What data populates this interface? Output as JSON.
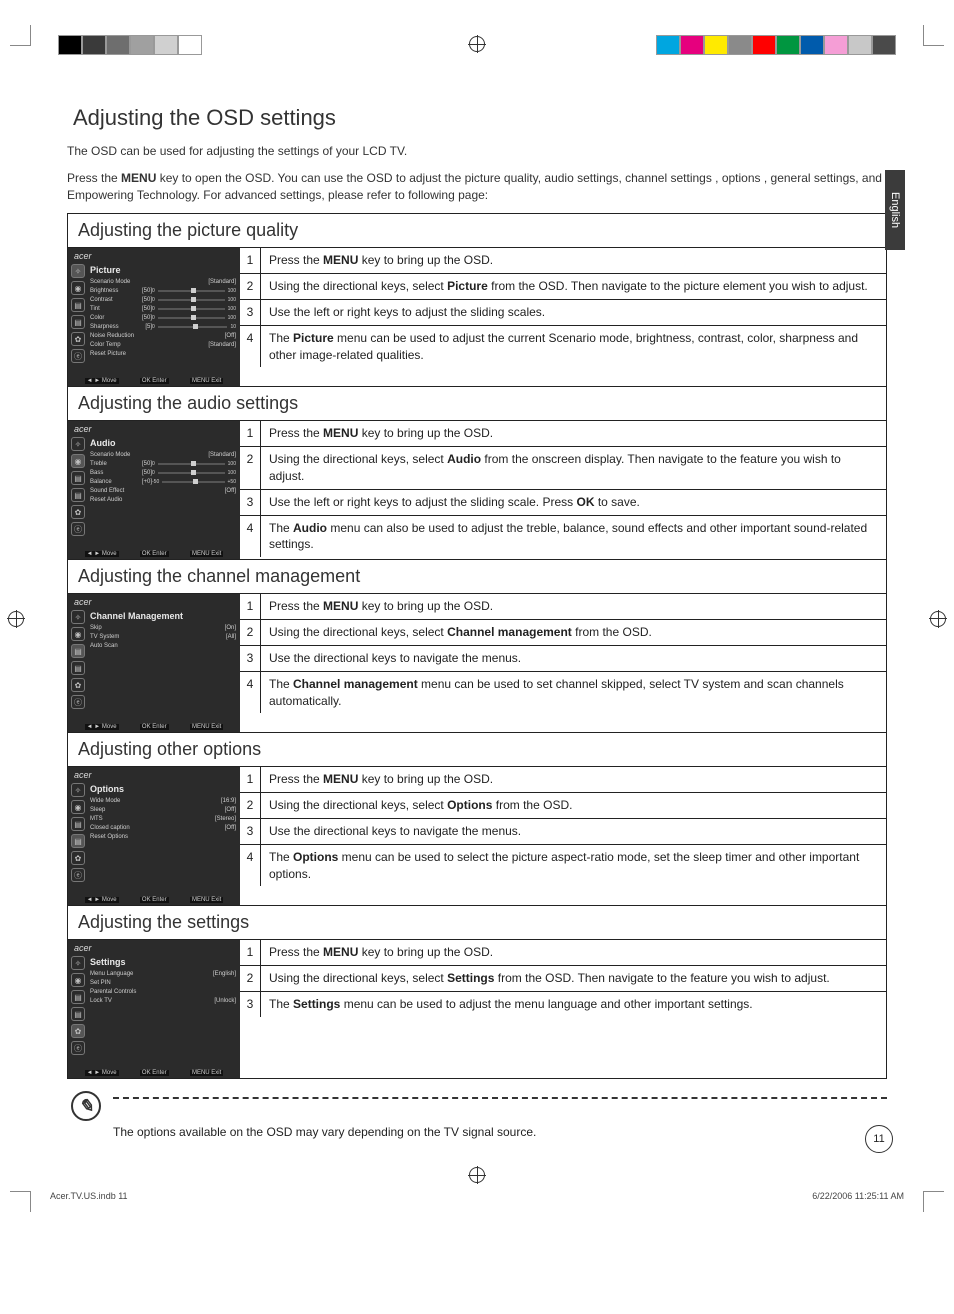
{
  "lang_tab": "English",
  "page_number": "11",
  "title": "Adjusting the OSD settings",
  "intro_plain": "The OSD can be used for adjusting the settings of your LCD TV.",
  "intro2_pre": "Press the ",
  "intro2_b": "MENU",
  "intro2_post": " key to open the OSD. You can use the OSD to adjust the picture quality, audio settings, channel settings , options , general settings, and Empowering Technology. For advanced settings, please refer to following page:",
  "sections": [
    {
      "title": "Adjusting the picture quality",
      "osd": {
        "brand": "acer",
        "menu": "Picture",
        "rows": [
          {
            "label": "Scenario Mode",
            "right": "[Standard]"
          },
          {
            "label": "Brightness",
            "val": "[50]",
            "slider": true,
            "min": "0",
            "max": "100"
          },
          {
            "label": "Contrast",
            "val": "[50]",
            "slider": true,
            "min": "0",
            "max": "100"
          },
          {
            "label": "Tint",
            "val": "[50]",
            "slider": true,
            "min": "0",
            "max": "100"
          },
          {
            "label": "Color",
            "val": "[50]",
            "slider": true,
            "min": "0",
            "max": "100"
          },
          {
            "label": "Sharpness",
            "val": "[5]",
            "slider": true,
            "min": "0",
            "max": "10"
          },
          {
            "label": "Noise Reduction",
            "right": "[Off]"
          },
          {
            "label": "Color Temp",
            "right": "[Standard]"
          },
          {
            "label": "Reset Picture"
          }
        ],
        "footer": [
          "◄ ► Move",
          "OK  Enter",
          "MENU  Exit"
        ]
      },
      "steps": [
        {
          "n": "1",
          "pre": "Press the ",
          "b": "MENU",
          "post": " key to bring up the OSD."
        },
        {
          "n": "2",
          "pre": "Using the directional keys, select ",
          "b": "Picture",
          "post": " from the OSD. Then navigate to the picture element you wish to adjust."
        },
        {
          "n": "3",
          "pre": "Use the left or right keys to adjust the sliding scales.",
          "b": "",
          "post": ""
        },
        {
          "n": "4",
          "pre": "The ",
          "b": "Picture",
          "post": " menu can be used to adjust the current Scenario mode, brightness, contrast, color, sharpness and other image-related qualities."
        }
      ]
    },
    {
      "title": "Adjusting the audio settings",
      "osd": {
        "brand": "acer",
        "menu": "Audio",
        "rows": [
          {
            "label": "Scenario Mode",
            "right": "[Standard]"
          },
          {
            "label": "Treble",
            "val": "[50]",
            "slider": true,
            "min": "0",
            "max": "100"
          },
          {
            "label": "Bass",
            "val": "[50]",
            "slider": true,
            "min": "0",
            "max": "100"
          },
          {
            "label": "Balance",
            "val": "[+0]",
            "slider": true,
            "min": "-50",
            "max": "+50"
          },
          {
            "label": "Sound Effect",
            "right": "[Off]"
          },
          {
            "label": "Reset Audio"
          }
        ],
        "footer": [
          "◄ ► Move",
          "OK  Enter",
          "MENU  Exit"
        ]
      },
      "steps": [
        {
          "n": "1",
          "pre": "Press the ",
          "b": "MENU",
          "post": " key to bring up the OSD."
        },
        {
          "n": "2",
          "pre": "Using the directional keys, select ",
          "b": "Audio",
          "post": " from the onscreen display. Then navigate to the feature you wish to adjust."
        },
        {
          "n": "3",
          "pre": "Use the left or right keys to adjust the sliding scale. Press ",
          "b": "OK",
          "post": " to save."
        },
        {
          "n": "4",
          "pre": "The ",
          "b": "Audio",
          "post": " menu can also be used to adjust the treble, balance, sound effects and other important sound-related settings."
        }
      ]
    },
    {
      "title": "Adjusting the channel management",
      "osd": {
        "brand": "acer",
        "menu": "Channel Management",
        "rows": [
          {
            "label": "Skip",
            "right": "[On]"
          },
          {
            "label": "TV System",
            "right": "[All]"
          },
          {
            "label": "Auto Scan"
          }
        ],
        "footer": [
          "◄ ► Move",
          "OK  Enter",
          "MENU  Exit"
        ]
      },
      "steps": [
        {
          "n": "1",
          "pre": "Press the ",
          "b": "MENU",
          "post": " key to bring up the OSD."
        },
        {
          "n": "2",
          "pre": "Using the directional keys, select ",
          "b": "Channel management",
          "post": " from the OSD."
        },
        {
          "n": "3",
          "pre": "Use the directional keys to navigate the menus.",
          "b": "",
          "post": ""
        },
        {
          "n": "4",
          "pre": "The ",
          "b": "Channel management",
          "post": " menu can be used to set channel skipped, select TV system and scan channels automatically."
        }
      ]
    },
    {
      "title": "Adjusting other options",
      "osd": {
        "brand": "acer",
        "menu": "Options",
        "rows": [
          {
            "label": "Wide Mode",
            "right": "[16:9]"
          },
          {
            "label": "Sleep",
            "right": "[Off]"
          },
          {
            "label": "MTS",
            "right": "[Stereo]"
          },
          {
            "label": "Closed caption",
            "right": "[Off]"
          },
          {
            "label": "Reset Options"
          }
        ],
        "footer": [
          "◄ ► Move",
          "OK  Enter",
          "MENU  Exit"
        ]
      },
      "steps": [
        {
          "n": "1",
          "pre": "Press the ",
          "b": "MENU",
          "post": " key to bring up the OSD."
        },
        {
          "n": "2",
          "pre": "Using the directional keys, select ",
          "b": "Options",
          "post": " from the OSD."
        },
        {
          "n": "3",
          "pre": "Use the directional keys to navigate the menus.",
          "b": "",
          "post": ""
        },
        {
          "n": "4",
          "pre": "The ",
          "b": "Options",
          "post": " menu can be used to select the picture aspect-ratio mode, set the sleep timer and other important options."
        }
      ]
    },
    {
      "title": "Adjusting the settings",
      "osd": {
        "brand": "acer",
        "menu": "Settings",
        "rows": [
          {
            "label": "Menu Language",
            "right": "[English]"
          },
          {
            "label": "Set PIN"
          },
          {
            "label": "Parental Controls"
          },
          {
            "label": "Lock TV",
            "right": "[Unlock]"
          }
        ],
        "footer": [
          "◄ ► Move",
          "OK  Enter",
          "MENU  Exit"
        ]
      },
      "steps": [
        {
          "n": "1",
          "pre": "Press the ",
          "b": "MENU",
          "post": " key to bring up the OSD."
        },
        {
          "n": "2",
          "pre": "Using the directional keys, select ",
          "b": "Settings",
          "post": " from the OSD. Then navigate to the feature you wish to adjust."
        },
        {
          "n": "3",
          "pre": "The ",
          "b": "Settings",
          "post": " menu can be used to adjust the menu language and other important settings."
        }
      ]
    }
  ],
  "note_text": "The options available on the OSD may vary depending on the TV signal source.",
  "footer_left": "Acer.TV.US.indb   11",
  "footer_right": "6/22/2006   11:25:11 AM",
  "swatches_left": [
    "#000",
    "#3a3a3a",
    "#6e6e6e",
    "#a0a0a0",
    "#d0d0d0",
    "#fff"
  ],
  "swatches_right": [
    "#00a6e0",
    "#e6007e",
    "#ffea00",
    "#8a8a8a",
    "#ff0000",
    "#009640",
    "#005bac",
    "#f59ed6",
    "#c8c8c8",
    "#4a4a4a"
  ]
}
